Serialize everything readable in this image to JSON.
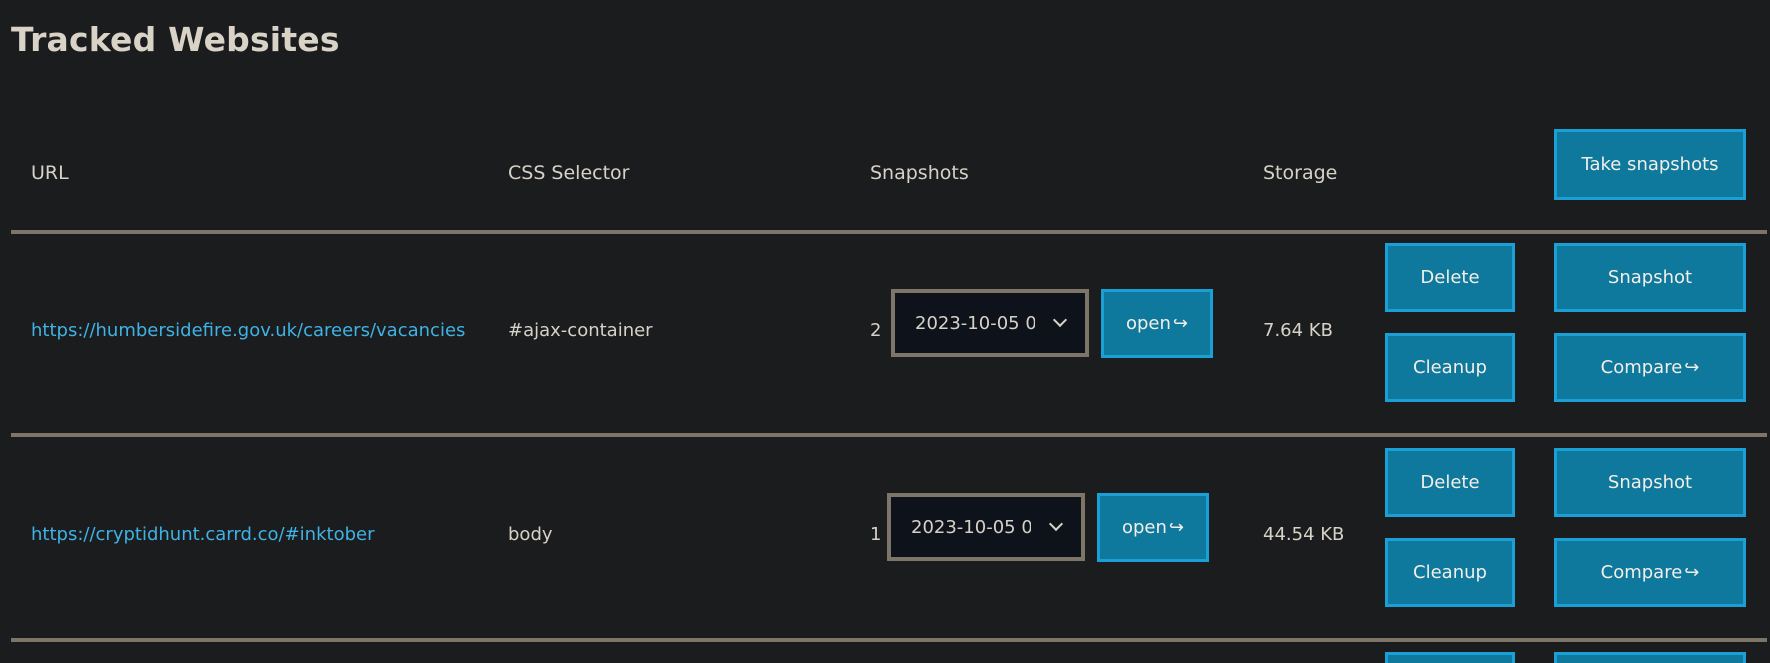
{
  "page": {
    "title": "Tracked Websites"
  },
  "table": {
    "headers": {
      "url": "URL",
      "css_selector": "CSS Selector",
      "snapshots": "Snapshots",
      "storage": "Storage"
    },
    "take_snapshots_label": "Take snapshots",
    "rows": [
      {
        "url": "https://humbersidefire.gov.uk/careers/vacancies",
        "css_selector": "#ajax-container",
        "snapshot_count": "2",
        "selected_snapshot": "2023-10-05 0(",
        "open_label": "open",
        "storage": "7.64 KB",
        "delete_label": "Delete",
        "cleanup_label": "Cleanup",
        "snapshot_label": "Snapshot",
        "compare_label": "Compare"
      },
      {
        "url": "https://cryptidhunt.carrd.co/#inktober",
        "css_selector": "body",
        "snapshot_count": "1",
        "selected_snapshot": "2023-10-05 0'",
        "open_label": "open",
        "storage": "44.54 KB",
        "delete_label": "Delete",
        "cleanup_label": "Cleanup",
        "snapshot_label": "Snapshot",
        "compare_label": "Compare"
      }
    ]
  },
  "icons": {
    "external": "↪",
    "dropdown": "chevron-down-icon"
  },
  "colors": {
    "background": "#1b1c1e",
    "button_fill": "#0f789d",
    "button_border": "#1b9fd7",
    "link": "#3fb2e6",
    "divider": "#7d7568"
  }
}
